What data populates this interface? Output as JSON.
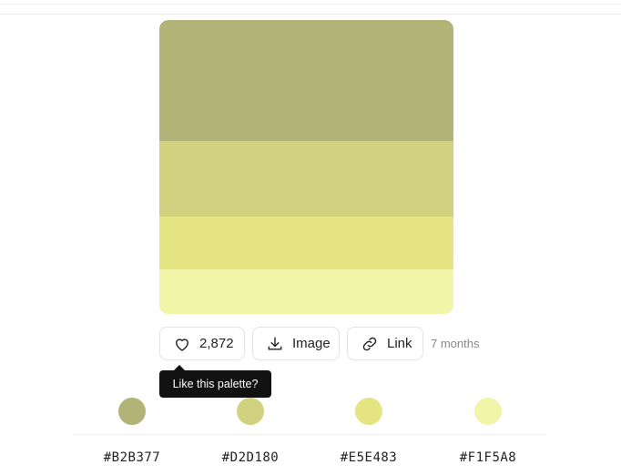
{
  "palette": {
    "swatches": [
      {
        "hex": "#B2B377",
        "weight": 133
      },
      {
        "hex": "#D2D180",
        "weight": 83
      },
      {
        "hex": "#E5E483",
        "weight": 58
      },
      {
        "hex": "#F1F5A8",
        "weight": 49
      }
    ]
  },
  "actions": {
    "like_count": "2,872",
    "like_icon": "heart-icon",
    "image_label": "Image",
    "image_icon": "download-icon",
    "link_label": "Link",
    "link_icon": "link-icon",
    "time_ago": "7 months"
  },
  "tooltip": {
    "text": "Like this palette?"
  },
  "colors": [
    {
      "hex": "#B2B377",
      "label": "#B2B377"
    },
    {
      "hex": "#D2D180",
      "label": "#D2D180"
    },
    {
      "hex": "#E5E483",
      "label": "#E5E483"
    },
    {
      "hex": "#F1F5A8",
      "label": "#F1F5A8"
    }
  ]
}
